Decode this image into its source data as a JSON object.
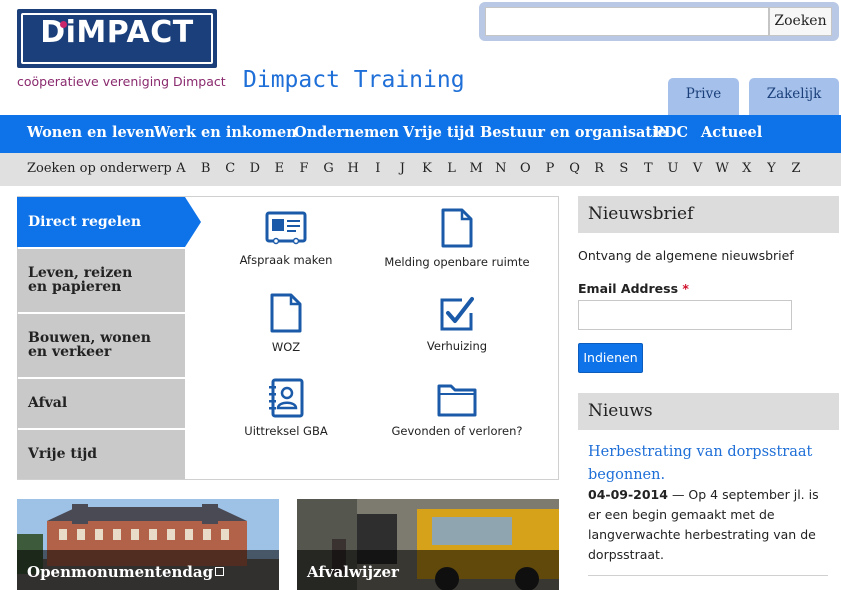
{
  "header": {
    "logo_text": "DiMPACT",
    "logo_subtitle": "coöperatieve vereniging Dimpact",
    "site_title": "Dimpact Training",
    "search": {
      "placeholder": "",
      "button_label": "Zoeken"
    },
    "tabs": [
      {
        "label": "Prive"
      },
      {
        "label": "Zakelijk"
      }
    ]
  },
  "mainnav": {
    "items": [
      {
        "label": "Wonen en leven"
      },
      {
        "label": "Werk en inkomen"
      },
      {
        "label": "Ondernemen"
      },
      {
        "label": "Vrije tijd"
      },
      {
        "label": "Bestuur en organisatie"
      },
      {
        "label": "PDC"
      },
      {
        "label": "Actueel"
      }
    ]
  },
  "alphabet": {
    "label": "Zoeken op onderwerp",
    "letters": [
      "A",
      "B",
      "C",
      "D",
      "E",
      "F",
      "G",
      "H",
      "I",
      "J",
      "K",
      "L",
      "M",
      "N",
      "O",
      "P",
      "Q",
      "R",
      "S",
      "T",
      "U",
      "V",
      "W",
      "X",
      "Y",
      "Z"
    ]
  },
  "left_tabs": [
    {
      "label": "Direct regelen"
    },
    {
      "label": "Leven, reizen en papieren"
    },
    {
      "label": "Bouwen, wonen en verkeer"
    },
    {
      "label": "Afval"
    },
    {
      "label": "Vrije tijd"
    }
  ],
  "services": [
    {
      "label": "Afspraak maken",
      "icon": "id-card-icon"
    },
    {
      "label": "Melding openbare ruimte",
      "icon": "document-icon"
    },
    {
      "label": "WOZ",
      "icon": "document-icon"
    },
    {
      "label": "Verhuizing",
      "icon": "checkbox-icon"
    },
    {
      "label": "Uittreksel GBA",
      "icon": "address-book-icon"
    },
    {
      "label": "Gevonden of verloren?",
      "icon": "folder-icon"
    }
  ],
  "newsletter": {
    "heading": "Nieuwsbrief",
    "description": "Ontvang de algemene nieuwsbrief",
    "email_label": "Email Address",
    "required_mark": "*",
    "email_value": "",
    "submit_label": "Indienen"
  },
  "news": {
    "heading": "Nieuws",
    "item": {
      "title": "Herbestrating van dorpsstraat begonnen.",
      "date": "04-09-2014",
      "separator": " — ",
      "body": "Op 4 september jl. is er een begin gemaakt met de langverwachte herbestrating van de dorpsstraat."
    }
  },
  "promos": [
    {
      "label": "Openmonumentendag"
    },
    {
      "label": "Afvalwijzer"
    }
  ],
  "colors": {
    "brand_blue": "#0e73e8",
    "logo_navy": "#1a3f7a",
    "link_blue": "#1f6fd8",
    "icon_blue": "#1a5aa8"
  }
}
